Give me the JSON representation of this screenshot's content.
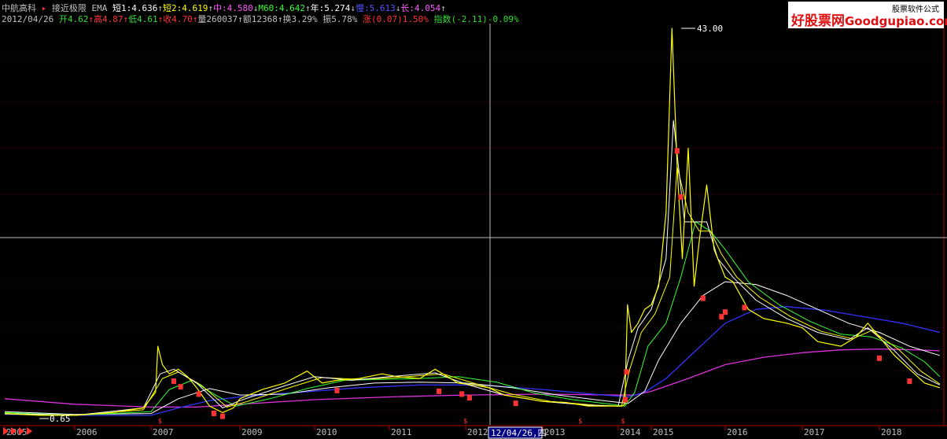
{
  "header": {
    "stock_name": "中航高科",
    "indicator_name": "接近极限 EMA",
    "ma_items": [
      {
        "label": "短1:4.636",
        "arrow": "↑",
        "cls": "ma1"
      },
      {
        "label": "短2:4.619",
        "arrow": "↑",
        "cls": "ma2"
      },
      {
        "label": "中:4.580",
        "arrow": "↓",
        "cls": "ma3"
      },
      {
        "label": "M60:4.642",
        "arrow": "↑",
        "cls": "ma4"
      },
      {
        "label": "年:5.274",
        "arrow": "↓",
        "cls": "ma5"
      },
      {
        "label": "慢:5.613",
        "arrow": "↓",
        "cls": "ma6"
      },
      {
        "label": "长:4.054",
        "arrow": "↑",
        "cls": "ma7"
      }
    ]
  },
  "quote": {
    "date": "2012/04/26",
    "open_label": "开",
    "open": "4.62",
    "high_label": "高",
    "high": "4.87",
    "low_label": "低",
    "low": "4.61",
    "close_label": "收",
    "close": "4.70",
    "volume_label": "量",
    "volume": "260037",
    "amount_label": "额",
    "amount": "12368",
    "turnover_label": "换",
    "turnover": "3.29%",
    "amplitude_label": "振",
    "amplitude": "5.78%",
    "change_label": "涨",
    "change": "(0.07)1.50%",
    "index_label": "指数",
    "index_change": "(-2.11)-0.09%"
  },
  "watermark": {
    "top_text": "股票软件公式",
    "cn_text": "好股票网",
    "en_text": "Goodgupiao.com"
  },
  "colors": {
    "background": "#000000",
    "grid": "#7a0000",
    "up": "#ff3333",
    "down": "#33dd33",
    "ma_white": "#ffffff",
    "ma_yellow": "#ffff00",
    "ma_green": "#33ff33",
    "ma_blue": "#3333ff",
    "ma_magenta": "#dd33dd",
    "crosshair": "#bbbbbb"
  },
  "crosshair": {
    "date_label": "12/04/26,四"
  },
  "chart_data": {
    "type": "line",
    "x_tick_labels": [
      "2005",
      "2006",
      "2007",
      "2009",
      "2010",
      "2011",
      "2012",
      "2013",
      "2014",
      "2015",
      "2016",
      "2017",
      "2018"
    ],
    "price_max_label": "43.00",
    "price_min_label": "0.65",
    "price_max": 43.0,
    "price_min": 0.65,
    "series": [
      {
        "key": "close",
        "x": [
          2005.0,
          2005.5,
          2006.0,
          2006.5,
          2006.9,
          2007.1,
          2007.15,
          2007.25,
          2007.4,
          2007.6,
          2007.8,
          2008.0,
          2008.3,
          2008.6,
          2008.85,
          2009.0,
          2009.3,
          2009.6,
          2009.9,
          2010.1,
          2010.3,
          2010.6,
          2010.9,
          2011.1,
          2011.4,
          2011.6,
          2011.9,
          2012.1,
          2012.3,
          2012.5,
          2012.8,
          2013.0,
          2013.3,
          2013.6,
          2013.9,
          2014.1,
          2014.2,
          2014.25,
          2014.28,
          2014.4,
          2014.6,
          2014.8,
          2015.0,
          2015.1,
          2015.2,
          2015.28,
          2015.35,
          2015.42,
          2015.5,
          2015.58,
          2015.65,
          2015.75,
          2015.85,
          2015.95,
          2016.0,
          2016.1,
          2016.2,
          2016.3,
          2016.5,
          2016.8,
          2017.0,
          2017.2,
          2017.5,
          2017.7,
          2017.85,
          2018.0,
          2018.2,
          2018.4,
          2018.6,
          2018.8
        ],
        "y": [
          1.2,
          1.0,
          1.0,
          1.3,
          1.8,
          3.5,
          8.5,
          6.5,
          5.5,
          6.0,
          5.2,
          4.0,
          2.0,
          1.3,
          1.8,
          2.8,
          3.8,
          4.5,
          5.8,
          4.5,
          4.8,
          5.0,
          5.5,
          5.2,
          5.0,
          6.0,
          4.5,
          4.3,
          4.0,
          3.2,
          2.8,
          2.5,
          2.4,
          2.0,
          2.0,
          2.0,
          2.2,
          9.0,
          13.0,
          10.0,
          11.0,
          12.5,
          13.0,
          15.0,
          23.0,
          43.0,
          28.0,
          18.0,
          30.0,
          15.0,
          20.0,
          26.0,
          19.0,
          17.0,
          16.0,
          15.5,
          14.0,
          12.5,
          11.5,
          11.0,
          10.5,
          9.0,
          8.5,
          9.5,
          11.0,
          9.5,
          7.5,
          6.0,
          4.5,
          4.0
        ]
      },
      {
        "key": "ma_short1",
        "x": [
          2005.0,
          2006.0,
          2006.9,
          2007.2,
          2007.5,
          2008.0,
          2008.6,
          2009.0,
          2009.6,
          2010.0,
          2010.5,
          2011.0,
          2011.6,
          2012.0,
          2012.5,
          2013.0,
          2013.6,
          2014.0,
          2014.3,
          2014.6,
          2015.0,
          2015.2,
          2015.3,
          2015.45,
          2015.6,
          2015.75,
          2015.9,
          2016.1,
          2016.4,
          2016.8,
          2017.2,
          2017.6,
          2017.85,
          2018.2,
          2018.5,
          2018.8
        ],
        "y": [
          1.2,
          1.0,
          1.8,
          5.5,
          6.0,
          4.5,
          1.8,
          2.6,
          4.2,
          5.2,
          4.8,
          5.2,
          5.6,
          4.4,
          3.2,
          2.5,
          2.1,
          2.0,
          7.0,
          10.5,
          12.5,
          18.0,
          33.0,
          22.0,
          22.0,
          22.0,
          18.0,
          16.0,
          13.5,
          11.5,
          10.0,
          9.2,
          10.5,
          8.0,
          5.5,
          4.3
        ]
      },
      {
        "key": "ma_short2",
        "x": [
          2005.0,
          2006.0,
          2006.9,
          2007.25,
          2007.6,
          2008.1,
          2008.7,
          2009.1,
          2009.7,
          2010.1,
          2010.6,
          2011.1,
          2011.7,
          2012.1,
          2012.6,
          2013.1,
          2013.7,
          2014.1,
          2014.35,
          2014.7,
          2015.05,
          2015.25,
          2015.35,
          2015.5,
          2015.65,
          2015.8,
          2015.95,
          2016.15,
          2016.45,
          2016.85,
          2017.25,
          2017.65,
          2017.9,
          2018.25,
          2018.55,
          2018.8
        ],
        "y": [
          1.15,
          1.0,
          1.6,
          5.0,
          5.7,
          4.3,
          1.9,
          2.5,
          4.1,
          5.1,
          4.9,
          5.1,
          5.5,
          4.5,
          3.3,
          2.5,
          2.1,
          2.0,
          6.0,
          10.0,
          12.0,
          16.0,
          28.0,
          23.0,
          21.0,
          21.0,
          18.5,
          16.0,
          13.8,
          11.7,
          10.1,
          9.3,
          10.2,
          8.2,
          5.8,
          4.4
        ]
      },
      {
        "key": "ma_m60",
        "x": [
          2005.0,
          2006.0,
          2007.0,
          2007.4,
          2007.9,
          2008.4,
          2008.9,
          2009.4,
          2009.9,
          2010.4,
          2010.9,
          2011.4,
          2011.9,
          2012.4,
          2012.9,
          2013.4,
          2013.9,
          2014.2,
          2014.5,
          2014.9,
          2015.2,
          2015.4,
          2015.6,
          2015.8,
          2016.0,
          2016.3,
          2016.7,
          2017.1,
          2017.5,
          2017.9,
          2018.3,
          2018.6,
          2018.8
        ],
        "y": [
          1.3,
          1.0,
          1.4,
          3.8,
          4.8,
          3.3,
          2.0,
          2.8,
          3.9,
          4.8,
          4.9,
          5.0,
          5.2,
          4.6,
          3.4,
          2.7,
          2.2,
          2.0,
          3.5,
          8.5,
          11.0,
          16.0,
          22.0,
          21.0,
          19.0,
          15.5,
          13.0,
          11.2,
          9.8,
          9.5,
          8.3,
          6.8,
          5.2
        ]
      },
      {
        "key": "ma_year",
        "x": [
          2005.0,
          2006.0,
          2007.0,
          2007.6,
          2008.3,
          2009.0,
          2009.6,
          2010.2,
          2010.8,
          2011.4,
          2012.0,
          2012.6,
          2013.2,
          2013.8,
          2014.3,
          2014.8,
          2015.1,
          2015.4,
          2015.7,
          2016.0,
          2016.4,
          2016.8,
          2017.2,
          2017.6,
          2018.0,
          2018.4,
          2018.8
        ],
        "y": [
          1.4,
          1.1,
          1.2,
          2.8,
          3.9,
          3.2,
          3.3,
          4.0,
          4.5,
          4.6,
          4.5,
          4.0,
          3.2,
          2.6,
          2.3,
          3.6,
          7.0,
          11.0,
          14.0,
          15.5,
          15.2,
          14.0,
          12.5,
          11.0,
          10.0,
          8.5,
          7.5
        ]
      },
      {
        "key": "ma_slow",
        "x": [
          2005.0,
          2006.0,
          2007.0,
          2007.6,
          2008.3,
          2009.0,
          2009.8,
          2010.6,
          2011.4,
          2012.2,
          2013.0,
          2013.8,
          2014.3,
          2014.8,
          2015.2,
          2015.6,
          2016.0,
          2016.4,
          2016.8,
          2017.3,
          2017.8,
          2018.3,
          2018.8
        ],
        "y": [
          1.1,
          1.0,
          1.0,
          1.8,
          2.6,
          3.0,
          3.5,
          4.0,
          4.3,
          4.3,
          3.8,
          3.2,
          3.0,
          3.5,
          5.0,
          8.0,
          11.0,
          12.5,
          12.8,
          12.4,
          11.7,
          11.0,
          10.0
        ]
      },
      {
        "key": "ma_long",
        "x": [
          2005.0,
          2006.0,
          2007.0,
          2008.0,
          2009.0,
          2010.0,
          2011.0,
          2012.0,
          2013.0,
          2014.0,
          2014.5,
          2015.0,
          2015.5,
          2016.0,
          2016.5,
          2017.0,
          2017.5,
          2018.0,
          2018.5,
          2018.8
        ],
        "y": [
          2.8,
          2.2,
          1.9,
          1.9,
          2.2,
          2.7,
          3.0,
          3.2,
          3.3,
          3.2,
          3.2,
          3.6,
          5.0,
          6.5,
          7.3,
          7.8,
          8.1,
          8.2,
          8.1,
          8.0
        ]
      }
    ]
  }
}
